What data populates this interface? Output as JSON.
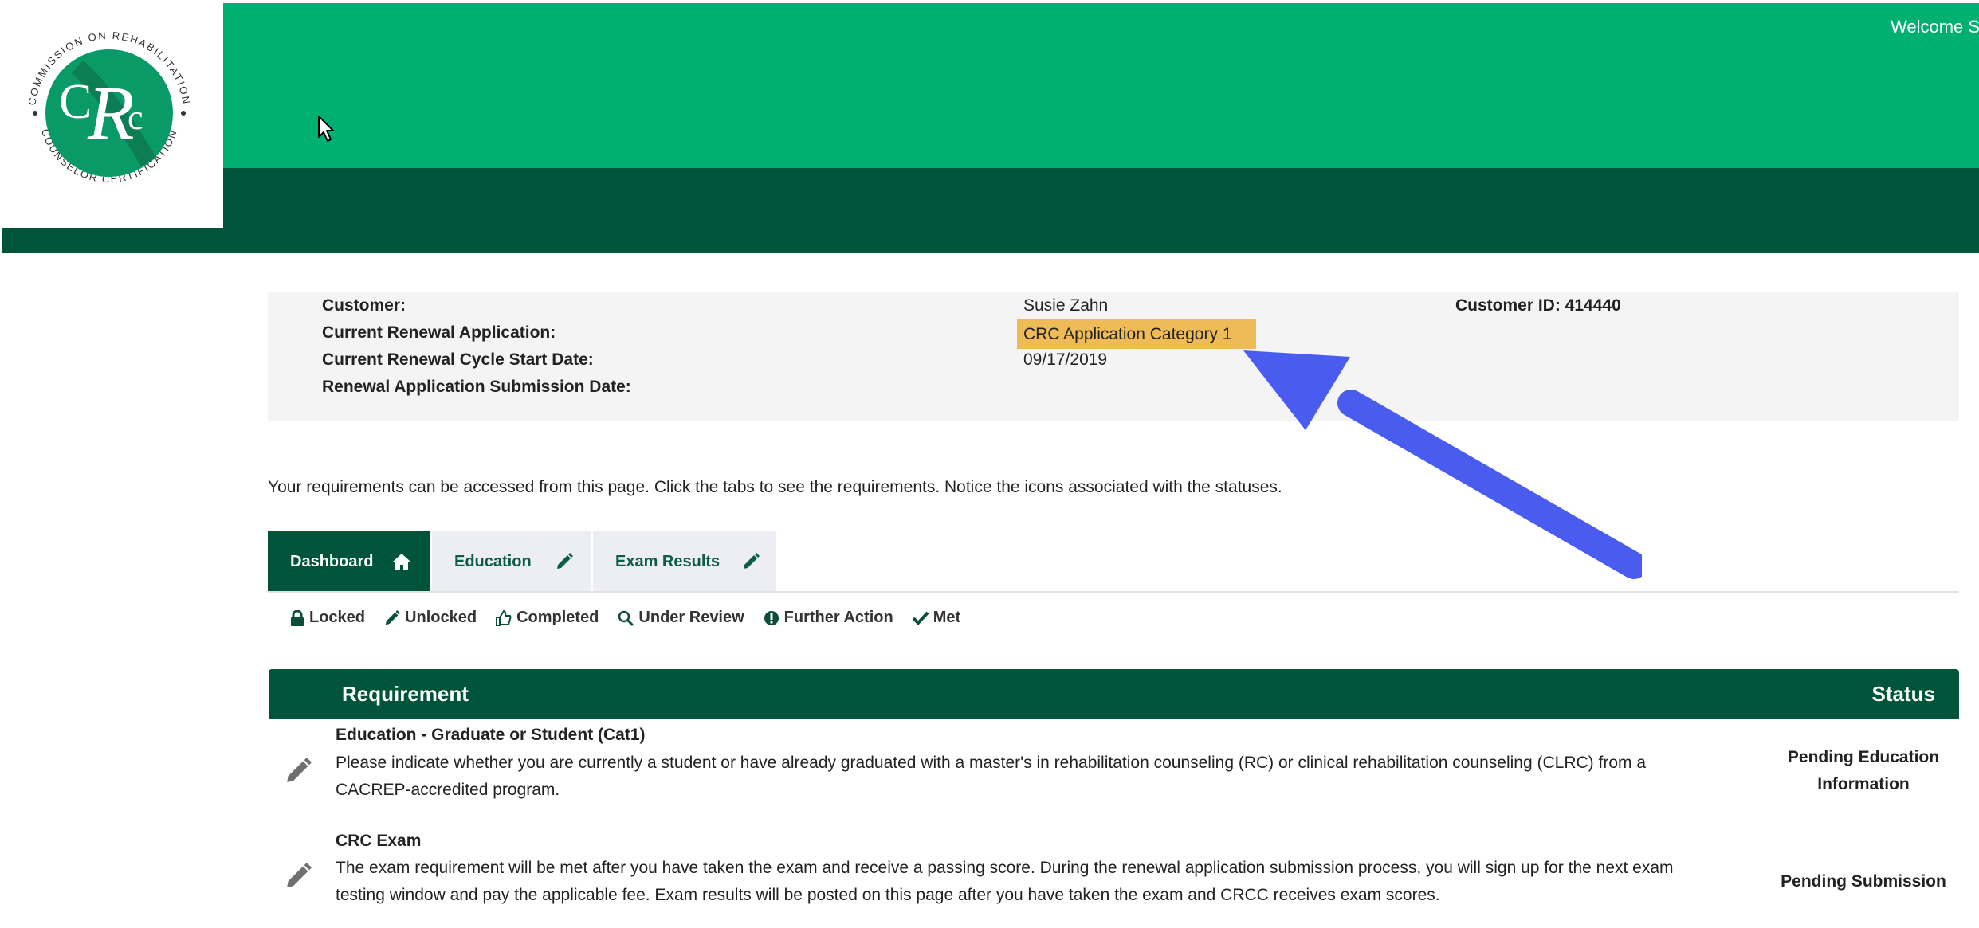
{
  "header": {
    "welcome_text": "Welcome S",
    "logo": {
      "ring_text_top": "COMMISSION ON REHABILITATION",
      "ring_text_bottom": "COUNSELOR CERTIFICATION",
      "initials": "CRC",
      "brand_color": "#0a9a68"
    },
    "colors": {
      "band": "#00b072",
      "dark_band": "#00543a"
    }
  },
  "customer_info": {
    "customer_label": "Customer:",
    "customer_value": "Susie Zahn",
    "customer_id_label": "Customer ID: 414440",
    "renewal_app_label": "Current Renewal Application:",
    "renewal_app_value": "CRC Application Category 1",
    "cycle_start_label": "Current Renewal Cycle Start Date:",
    "cycle_start_value": "09/17/2019",
    "submission_label": "Renewal Application Submission Date:",
    "submission_value": "",
    "highlight_color": "#efbb57"
  },
  "annotation": {
    "arrow_color": "#4a5cf0"
  },
  "intro_text": "Your requirements can be accessed from this page. Click the tabs to see the requirements. Notice the icons associated with the statuses.",
  "tabs": [
    {
      "label": "Dashboard",
      "icon": "home-icon",
      "active": true
    },
    {
      "label": "Education",
      "icon": "pencil-icon",
      "active": false
    },
    {
      "label": "Exam Results",
      "icon": "pencil-icon",
      "active": false
    }
  ],
  "legend": [
    {
      "label": "Locked",
      "icon": "lock-icon"
    },
    {
      "label": "Unlocked",
      "icon": "pencil-icon"
    },
    {
      "label": "Completed",
      "icon": "thumbs-up-icon"
    },
    {
      "label": "Under Review",
      "icon": "search-icon"
    },
    {
      "label": "Further Action",
      "icon": "exclamation-circle-icon"
    },
    {
      "label": "Met",
      "icon": "check-icon"
    }
  ],
  "table": {
    "header_requirement": "Requirement",
    "header_status": "Status",
    "rows": [
      {
        "icon": "pencil-icon",
        "title": "Education - Graduate or Student (Cat1)",
        "desc_line1": "Please indicate whether you are currently a student or have already graduated with a master's in rehabilitation counseling (RC) or clinical rehabilitation counseling (CLRC) from a",
        "desc_line2": "CACREP-accredited program.",
        "status_line1": "Pending Education",
        "status_line2": "Information"
      },
      {
        "icon": "pencil-icon",
        "title": "CRC Exam",
        "desc_line1": "The exam requirement will be met after you have taken the exam and receive a passing score.  During the renewal application submission process, you will sign up for the next exam",
        "desc_line2": "testing window and pay the applicable fee.  Exam results will be posted on this page after you have taken the exam and CRCC receives exam scores.",
        "status_line1": "Pending Submission",
        "status_line2": ""
      }
    ]
  }
}
